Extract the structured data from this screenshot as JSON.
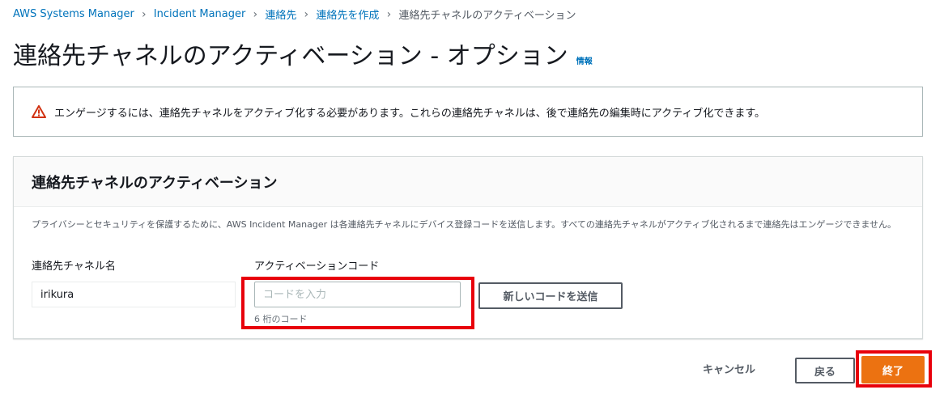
{
  "breadcrumb": {
    "items": [
      {
        "label": "AWS Systems Manager"
      },
      {
        "label": "Incident Manager"
      },
      {
        "label": "連絡先"
      },
      {
        "label": "連絡先を作成"
      },
      {
        "label": "連絡先チャネルのアクティベーション"
      }
    ],
    "separator": "›"
  },
  "header": {
    "title": "連絡先チャネルのアクティベーション - オプション",
    "info_label": "情報"
  },
  "alert": {
    "icon": "warning-triangle-icon",
    "text": "エンゲージするには、連絡先チャネルをアクティブ化する必要があります。これらの連絡先チャネルは、後で連絡先の編集時にアクティブ化できます。"
  },
  "activation": {
    "title": "連絡先チャネルのアクティベーション",
    "description": "プライバシーとセキュリティを保護するために、AWS Incident Manager は各連絡先チャネルにデバイス登録コードを送信します。すべての連絡先チャネルがアクティブ化されるまで連絡先はエンゲージできません。",
    "channel_name_label": "連絡先チャネル名",
    "channel_name_value": "irikura",
    "code_label": "アクティベーションコード",
    "code_value": "",
    "code_placeholder": "コードを入力",
    "code_hint": "6 桁のコード",
    "send_code_label": "新しいコードを送信"
  },
  "footer": {
    "cancel_label": "キャンセル",
    "back_label": "戻る",
    "finish_label": "終了"
  },
  "colors": {
    "link": "#0073bb",
    "primary": "#ec7211",
    "warning": "#d13212",
    "highlight": "#e8000b"
  }
}
